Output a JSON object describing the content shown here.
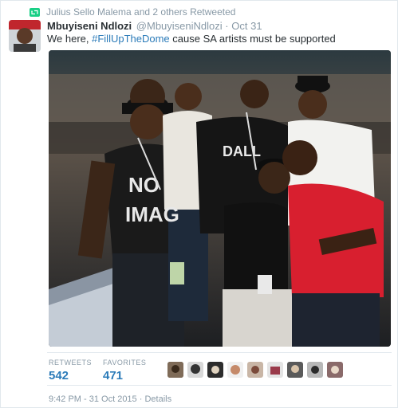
{
  "retweet_context": {
    "icon": "retweet-icon",
    "text": "Julius Sello Malema and 2 others Retweeted",
    "color": "#19cf86"
  },
  "tweet": {
    "author_name": "Mbuyiseni Ndlozi",
    "handle": "@MbuyiseniNdlozi",
    "separator": "·",
    "date": "Oct 31",
    "text_before": "We here, ",
    "hashtag": "#FillUpTheDome",
    "text_after": " cause SA artists must be supported",
    "photo_text_1": "NO",
    "photo_text_2": "IMAG",
    "photo_text_3": "DALL"
  },
  "stats": {
    "retweets_label": "RETWEETS",
    "retweets_count": "542",
    "favorites_label": "FAVORITES",
    "favorites_count": "471"
  },
  "footer": {
    "timestamp": "9:42 PM - 31 Oct 2015",
    "separator": "·",
    "details_link": "Details"
  },
  "colors": {
    "link": "#2b7bb9",
    "muted": "#8899a6",
    "text": "#292f33"
  }
}
